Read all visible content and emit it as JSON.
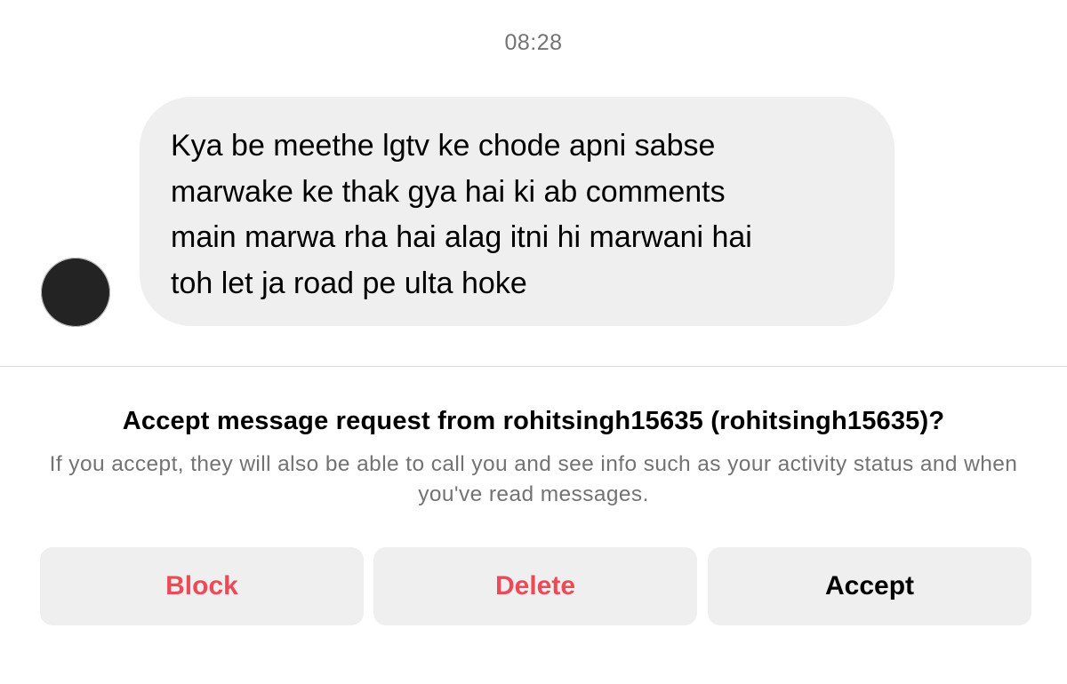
{
  "chat": {
    "timestamp": "08:28",
    "message": {
      "text": "Kya be meethe lgtv ke chode apni sabse\nmarwake ke thak gya hai ki ab comments\nmain marwa rha hai alag itni hi marwani hai\ntoh let ja road pe ulta hoke"
    },
    "avatar_icon": "profile-avatar"
  },
  "request": {
    "title": "Accept message request from rohitsingh15635 (rohitsingh15635)?",
    "description": "If you accept, they will also be able to call you and see info such as your activity status and when you've read messages."
  },
  "actions": {
    "block_label": "Block",
    "delete_label": "Delete",
    "accept_label": "Accept",
    "destructive_color": "#ed4956",
    "button_bg": "#efefef"
  }
}
